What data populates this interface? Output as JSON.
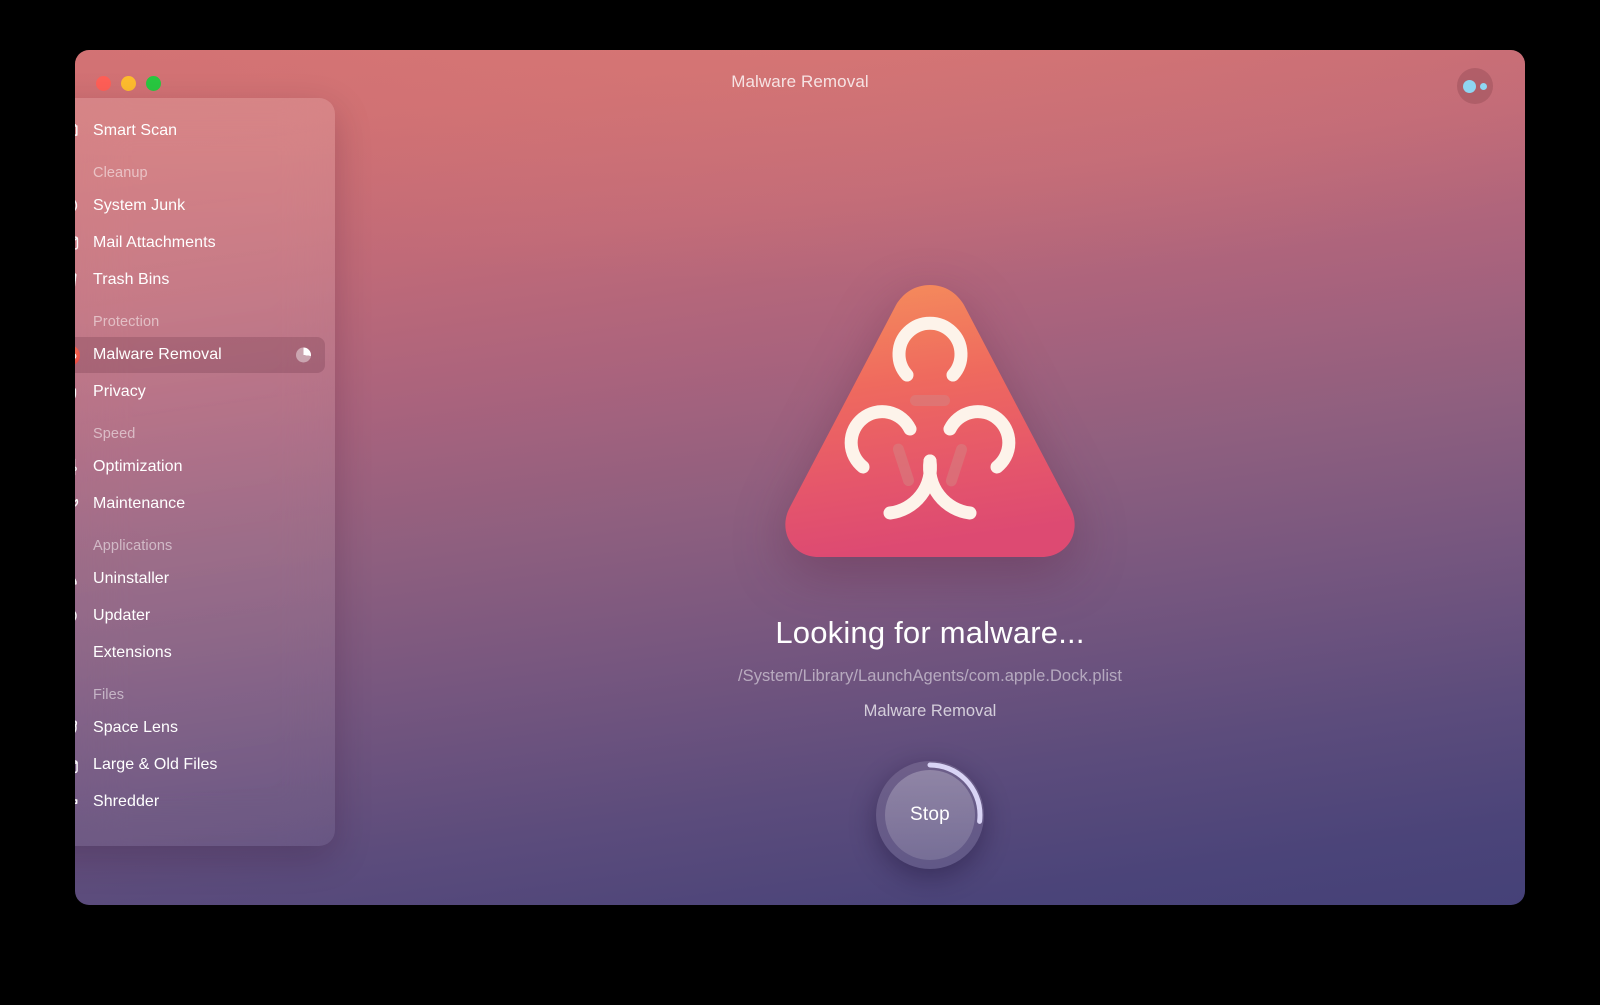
{
  "window": {
    "title": "Malware Removal",
    "traffic_lights": [
      {
        "name": "close",
        "color": "#ff5f57"
      },
      {
        "name": "minimize",
        "color": "#febc2e"
      },
      {
        "name": "maximize",
        "color": "#28c840"
      }
    ],
    "account_badge_color": "#8fd6f2",
    "background": {
      "top": "#d07074",
      "middle": "#8e5f7f",
      "bottom": "#454178"
    }
  },
  "sidebar": {
    "groups": [
      {
        "label": "",
        "items": [
          {
            "label": "Smart Scan",
            "icon": "monitor-icon",
            "selected": false
          }
        ]
      },
      {
        "label": "Cleanup",
        "items": [
          {
            "label": "System Junk",
            "icon": "broom-icon",
            "selected": false
          },
          {
            "label": "Mail Attachments",
            "icon": "envelope-icon",
            "selected": false
          },
          {
            "label": "Trash Bins",
            "icon": "trash-icon",
            "selected": false
          }
        ]
      },
      {
        "label": "Protection",
        "items": [
          {
            "label": "Malware Removal",
            "icon": "biohazard-icon",
            "selected": true,
            "progress": 27
          },
          {
            "label": "Privacy",
            "icon": "hand-icon",
            "selected": false
          }
        ]
      },
      {
        "label": "Speed",
        "items": [
          {
            "label": "Optimization",
            "icon": "sliders-icon",
            "selected": false
          },
          {
            "label": "Maintenance",
            "icon": "wrench-icon",
            "selected": false
          }
        ]
      },
      {
        "label": "Applications",
        "items": [
          {
            "label": "Uninstaller",
            "icon": "app-grid-icon",
            "selected": false
          },
          {
            "label": "Updater",
            "icon": "refresh-icon",
            "selected": false
          },
          {
            "label": "Extensions",
            "icon": "puzzle-icon",
            "selected": false
          }
        ]
      },
      {
        "label": "Files",
        "items": [
          {
            "label": "Space Lens",
            "icon": "planet-icon",
            "selected": false
          },
          {
            "label": "Large & Old Files",
            "icon": "folder-icon",
            "selected": false
          },
          {
            "label": "Shredder",
            "icon": "shredder-icon",
            "selected": false
          }
        ]
      }
    ]
  },
  "main": {
    "hero_icon": "biohazard-triangle-icon",
    "hero_colors": {
      "top": "#f2875c",
      "bottom": "#e0506d",
      "symbol": "#fdf3ea"
    },
    "scan_title": "Looking for malware...",
    "scan_path": "/System/Library/LaunchAgents/com.apple.Dock.plist",
    "scan_module": "Malware Removal",
    "stop_button_label": "Stop",
    "progress_percent": 27,
    "progress_arc_color": "#d9d4f5"
  }
}
